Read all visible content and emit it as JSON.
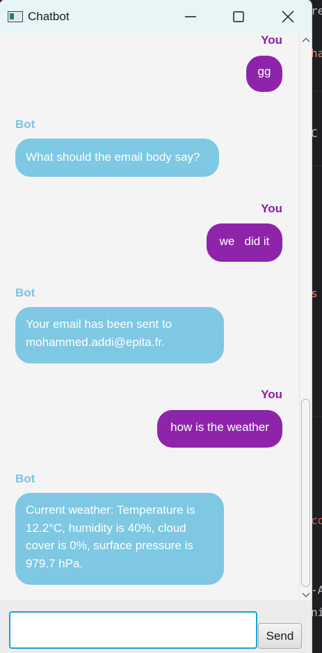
{
  "window": {
    "title": "Chatbot",
    "icons": {
      "app": "app-window-icon",
      "minimize": "minimize-icon",
      "maximize": "maximize-icon",
      "close": "close-icon"
    }
  },
  "messages": [
    {
      "sender": "You",
      "text": "gg"
    },
    {
      "sender": "Bot",
      "text": "What should the email body say?"
    },
    {
      "sender": "You",
      "text": "we   did it"
    },
    {
      "sender": "Bot",
      "text": "Your email has been sent to\nmohammed.addi@epita.fr."
    },
    {
      "sender": "You",
      "text": "how is the weather"
    },
    {
      "sender": "Bot",
      "text": "Current weather: Temperature is\n12.2°C, humidity is 40%, cloud\ncover is 0%, surface pressure is\n979.7 hPa."
    }
  ],
  "composer": {
    "input_value": "",
    "send_label": "Send"
  },
  "background_editor": {
    "fragments": [
      {
        "text": "re",
        "color": "#bcbec4"
      },
      {
        "text": "ha",
        "color": "#e88b6d"
      },
      {
        "text": "C",
        "color": "#bcbec4"
      },
      {
        "text": "s",
        "color": "#e88b6d"
      },
      {
        "text": "co",
        "color": "#e05555"
      },
      {
        "text": "-A",
        "color": "#bcbec4"
      },
      {
        "text": "ni",
        "color": "#bcbec4"
      }
    ]
  },
  "colors": {
    "you_bubble": "#8e24aa",
    "you_label": "#8a1fa3",
    "bot_bubble": "#7ec8e3",
    "bot_label": "#7ec4df",
    "input_focus": "#1ba2d4"
  }
}
